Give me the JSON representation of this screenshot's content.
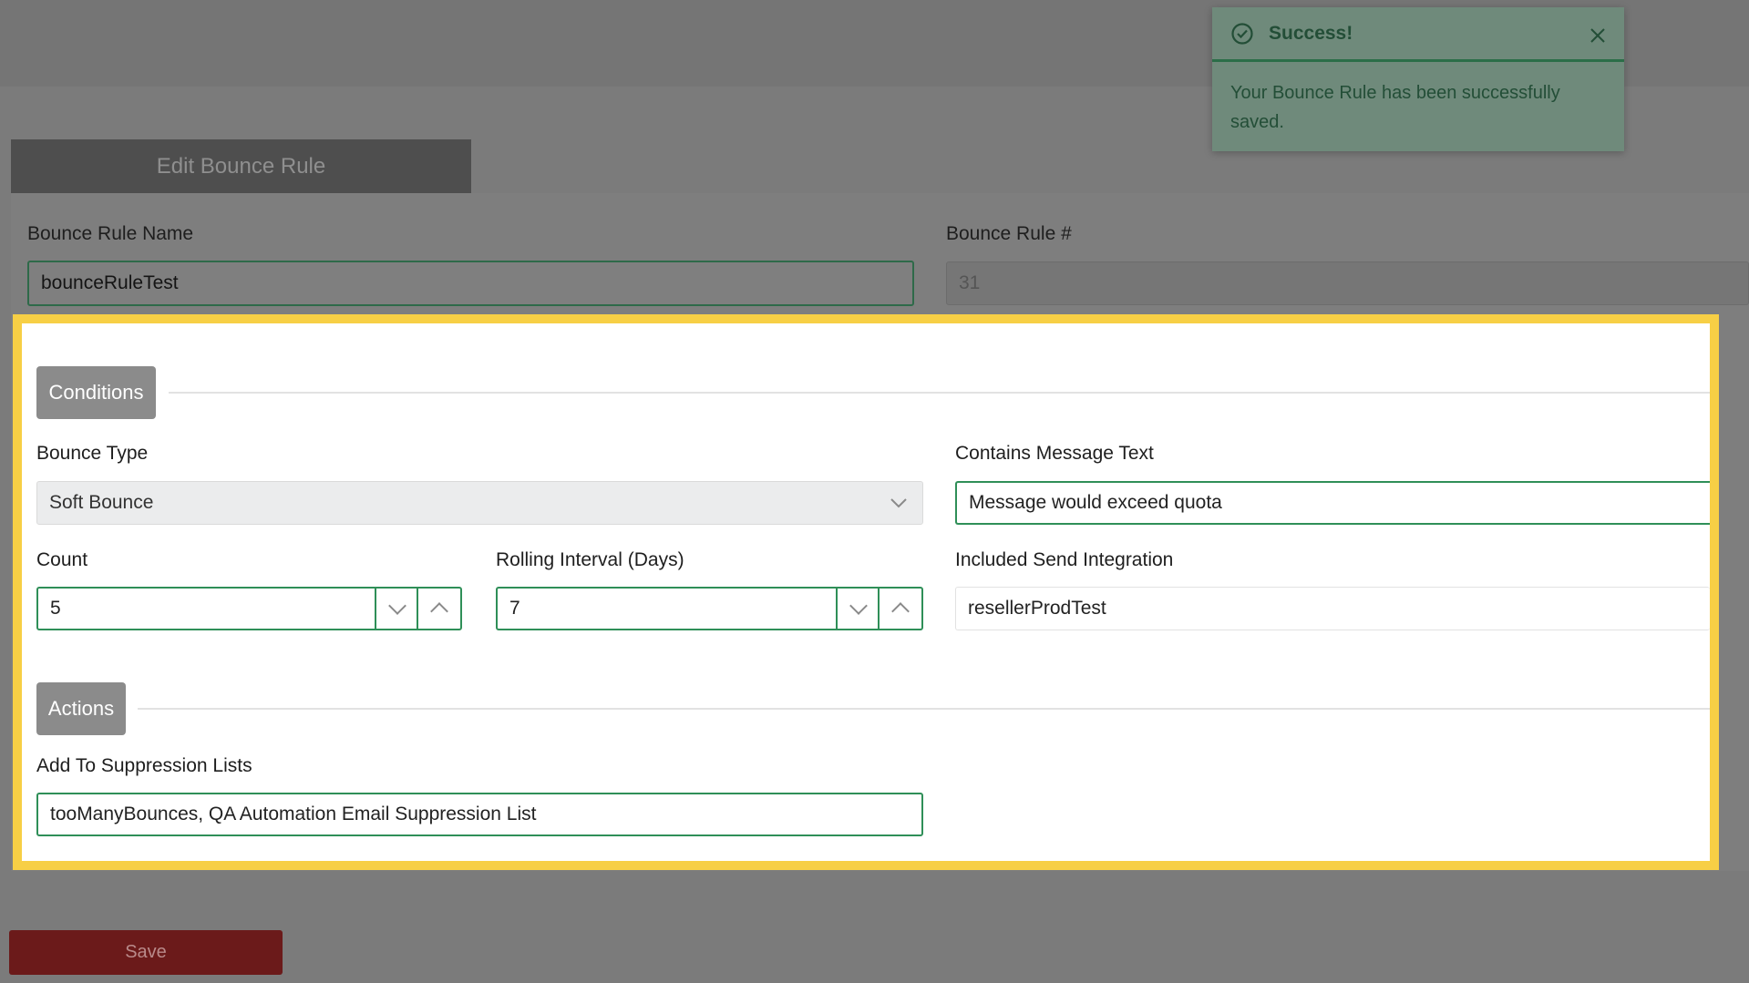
{
  "header": {
    "tab_title": "Edit Bounce Rule"
  },
  "toast": {
    "title": "Success!",
    "message": "Your Bounce Rule has been successfully saved.",
    "accent_color": "#2b6e48"
  },
  "rule": {
    "name_label": "Bounce Rule Name",
    "name_value": "bounceRuleTest",
    "number_label": "Bounce Rule #",
    "number_value": "31"
  },
  "conditions": {
    "section_label": "Conditions",
    "bounce_type_label": "Bounce Type",
    "bounce_type_value": "Soft Bounce",
    "contains_text_label": "Contains Message Text",
    "contains_text_value": "Message would exceed quota",
    "count_label": "Count",
    "count_value": "5",
    "interval_label": "Rolling Interval (Days)",
    "interval_value": "7",
    "integration_label": "Included Send Integration",
    "integration_value": "resellerProdTest"
  },
  "actions": {
    "section_label": "Actions",
    "suppression_label": "Add To Suppression Lists",
    "suppression_value": "tooManyBounces, QA Automation Email Suppression List"
  },
  "footer": {
    "save_label": "Save"
  },
  "colors": {
    "highlight": "#f7cf45",
    "field_border": "#2f8f58",
    "save": "#6b1a1a"
  }
}
